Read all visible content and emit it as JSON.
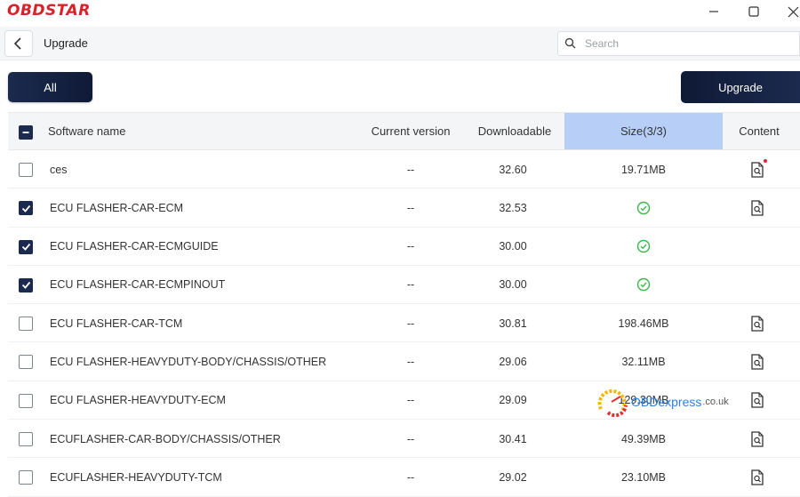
{
  "app": {
    "logo_text": "OBDSTAR"
  },
  "window_controls": {
    "minimize": "—",
    "maximize": "☐",
    "close": "✕"
  },
  "nav": {
    "title": "Upgrade"
  },
  "search": {
    "placeholder": "Search",
    "value": ""
  },
  "toolbar": {
    "tab_all": "All",
    "upgrade_label": "Upgrade"
  },
  "table": {
    "columns": {
      "name": "Software name",
      "current": "Current version",
      "downloadable": "Downloadable",
      "size": "Size(3/3)",
      "content": "Content"
    },
    "header_checkbox_state": "partial",
    "rows": [
      {
        "checked": false,
        "name": "ces",
        "current": "--",
        "downloadable": "32.60",
        "size": "19.71MB",
        "downloaded": false,
        "content_icon": true,
        "content_new": true
      },
      {
        "checked": true,
        "name": "ECU FLASHER-CAR-ECM",
        "current": "--",
        "downloadable": "32.53",
        "size": "",
        "downloaded": true,
        "content_icon": true,
        "content_new": false
      },
      {
        "checked": true,
        "name": "ECU FLASHER-CAR-ECMGUIDE",
        "current": "--",
        "downloadable": "30.00",
        "size": "",
        "downloaded": true,
        "content_icon": false,
        "content_new": false
      },
      {
        "checked": true,
        "name": "ECU FLASHER-CAR-ECMPINOUT",
        "current": "--",
        "downloadable": "30.00",
        "size": "",
        "downloaded": true,
        "content_icon": false,
        "content_new": false
      },
      {
        "checked": false,
        "name": "ECU FLASHER-CAR-TCM",
        "current": "--",
        "downloadable": "30.81",
        "size": "198.46MB",
        "downloaded": false,
        "content_icon": true,
        "content_new": false
      },
      {
        "checked": false,
        "name": "ECU FLASHER-HEAVYDUTY-BODY/CHASSIS/OTHER",
        "current": "--",
        "downloadable": "29.06",
        "size": "32.11MB",
        "downloaded": false,
        "content_icon": true,
        "content_new": false
      },
      {
        "checked": false,
        "name": "ECU FLASHER-HEAVYDUTY-ECM",
        "current": "--",
        "downloadable": "29.09",
        "size": "129.30MB",
        "downloaded": false,
        "content_icon": true,
        "content_new": false
      },
      {
        "checked": false,
        "name": "ECUFLASHER-CAR-BODY/CHASSIS/OTHER",
        "current": "--",
        "downloadable": "30.41",
        "size": "49.39MB",
        "downloaded": false,
        "content_icon": true,
        "content_new": false
      },
      {
        "checked": false,
        "name": "ECUFLASHER-HEAVYDUTY-TCM",
        "current": "--",
        "downloadable": "29.02",
        "size": "23.10MB",
        "downloaded": false,
        "content_icon": true,
        "content_new": false
      }
    ]
  },
  "watermark": {
    "brand": "OBDexpress",
    "tld": ".co.uk"
  },
  "colors": {
    "accent_dark": "#1b2a4e",
    "size_header": "#b7cef6",
    "done_green": "#3bb54a",
    "logo_red": "#d8222a"
  }
}
